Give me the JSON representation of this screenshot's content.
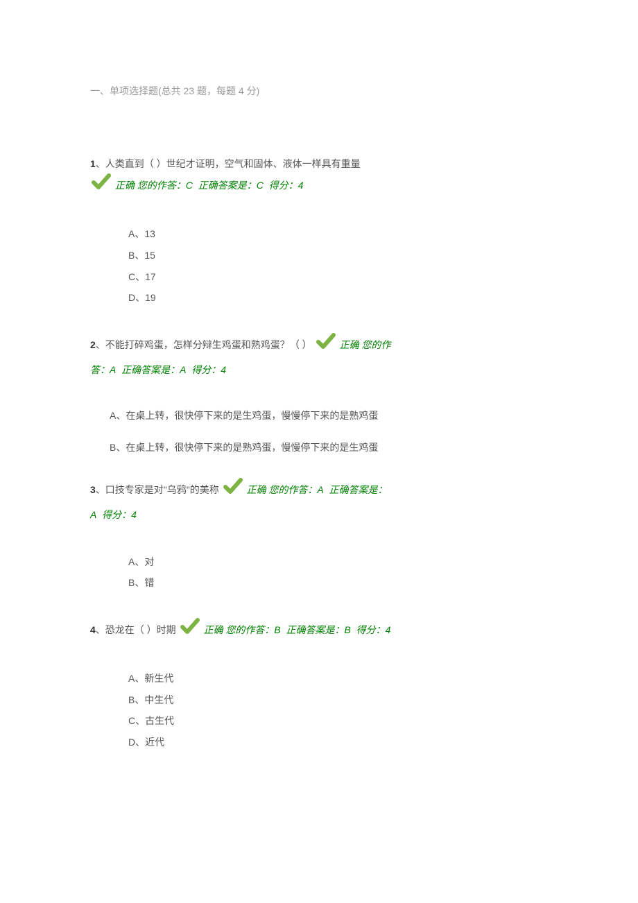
{
  "section": {
    "header": "一、单项选择题(总共 23 题，每题 4 分)"
  },
  "correct_label": "正确",
  "questions": [
    {
      "num": "1",
      "text": "、人类直到（ ）世纪才证明，空气和固体、液体一样具有重量",
      "your_answer_label": "您的作答：",
      "your_answer": "C",
      "correct_answer_label": "正确答案是：",
      "correct_answer": "C",
      "score_label": "得分：",
      "score": "4",
      "options": [
        {
          "label": "A、",
          "text": "13"
        },
        {
          "label": "B、",
          "text": "15"
        },
        {
          "label": "C、",
          "text": "17"
        },
        {
          "label": "D、",
          "text": "19"
        }
      ]
    },
    {
      "num": "2",
      "text": "、不能打碎鸡蛋，怎样分辩生鸡蛋和熟鸡蛋？（ ）",
      "your_answer_label": "您的作答：",
      "your_answer": "A",
      "correct_answer_label": "正确答案是：",
      "correct_answer": "A",
      "score_label": "得分：",
      "score": "4",
      "long_options": [
        "A、在桌上转，很快停下来的是生鸡蛋，慢慢停下来的是熟鸡蛋",
        "B、在桌上转，很快停下来的是熟鸡蛋，慢慢停下来的是生鸡蛋"
      ]
    },
    {
      "num": "3",
      "text": "、口技专家是对\"乌鸦\"的美称",
      "your_answer_label": "您的作答：",
      "your_answer": "A",
      "correct_answer_label": "正确答案是：",
      "correct_answer": "A",
      "score_label": "得分：",
      "score": "4",
      "options": [
        {
          "label": "A、",
          "text": "对"
        },
        {
          "label": "B、",
          "text": "错"
        }
      ]
    },
    {
      "num": "4",
      "text": "、恐龙在（ ）时期",
      "your_answer_label": "您的作答：",
      "your_answer": "B",
      "correct_answer_label": "正确答案是：",
      "correct_answer": "B",
      "score_label": "得分：",
      "score": "4",
      "options": [
        {
          "label": "A、",
          "text": "新生代"
        },
        {
          "label": "B、",
          "text": "中生代"
        },
        {
          "label": "C、",
          "text": "古生代"
        },
        {
          "label": "D、",
          "text": "近代"
        }
      ]
    }
  ]
}
